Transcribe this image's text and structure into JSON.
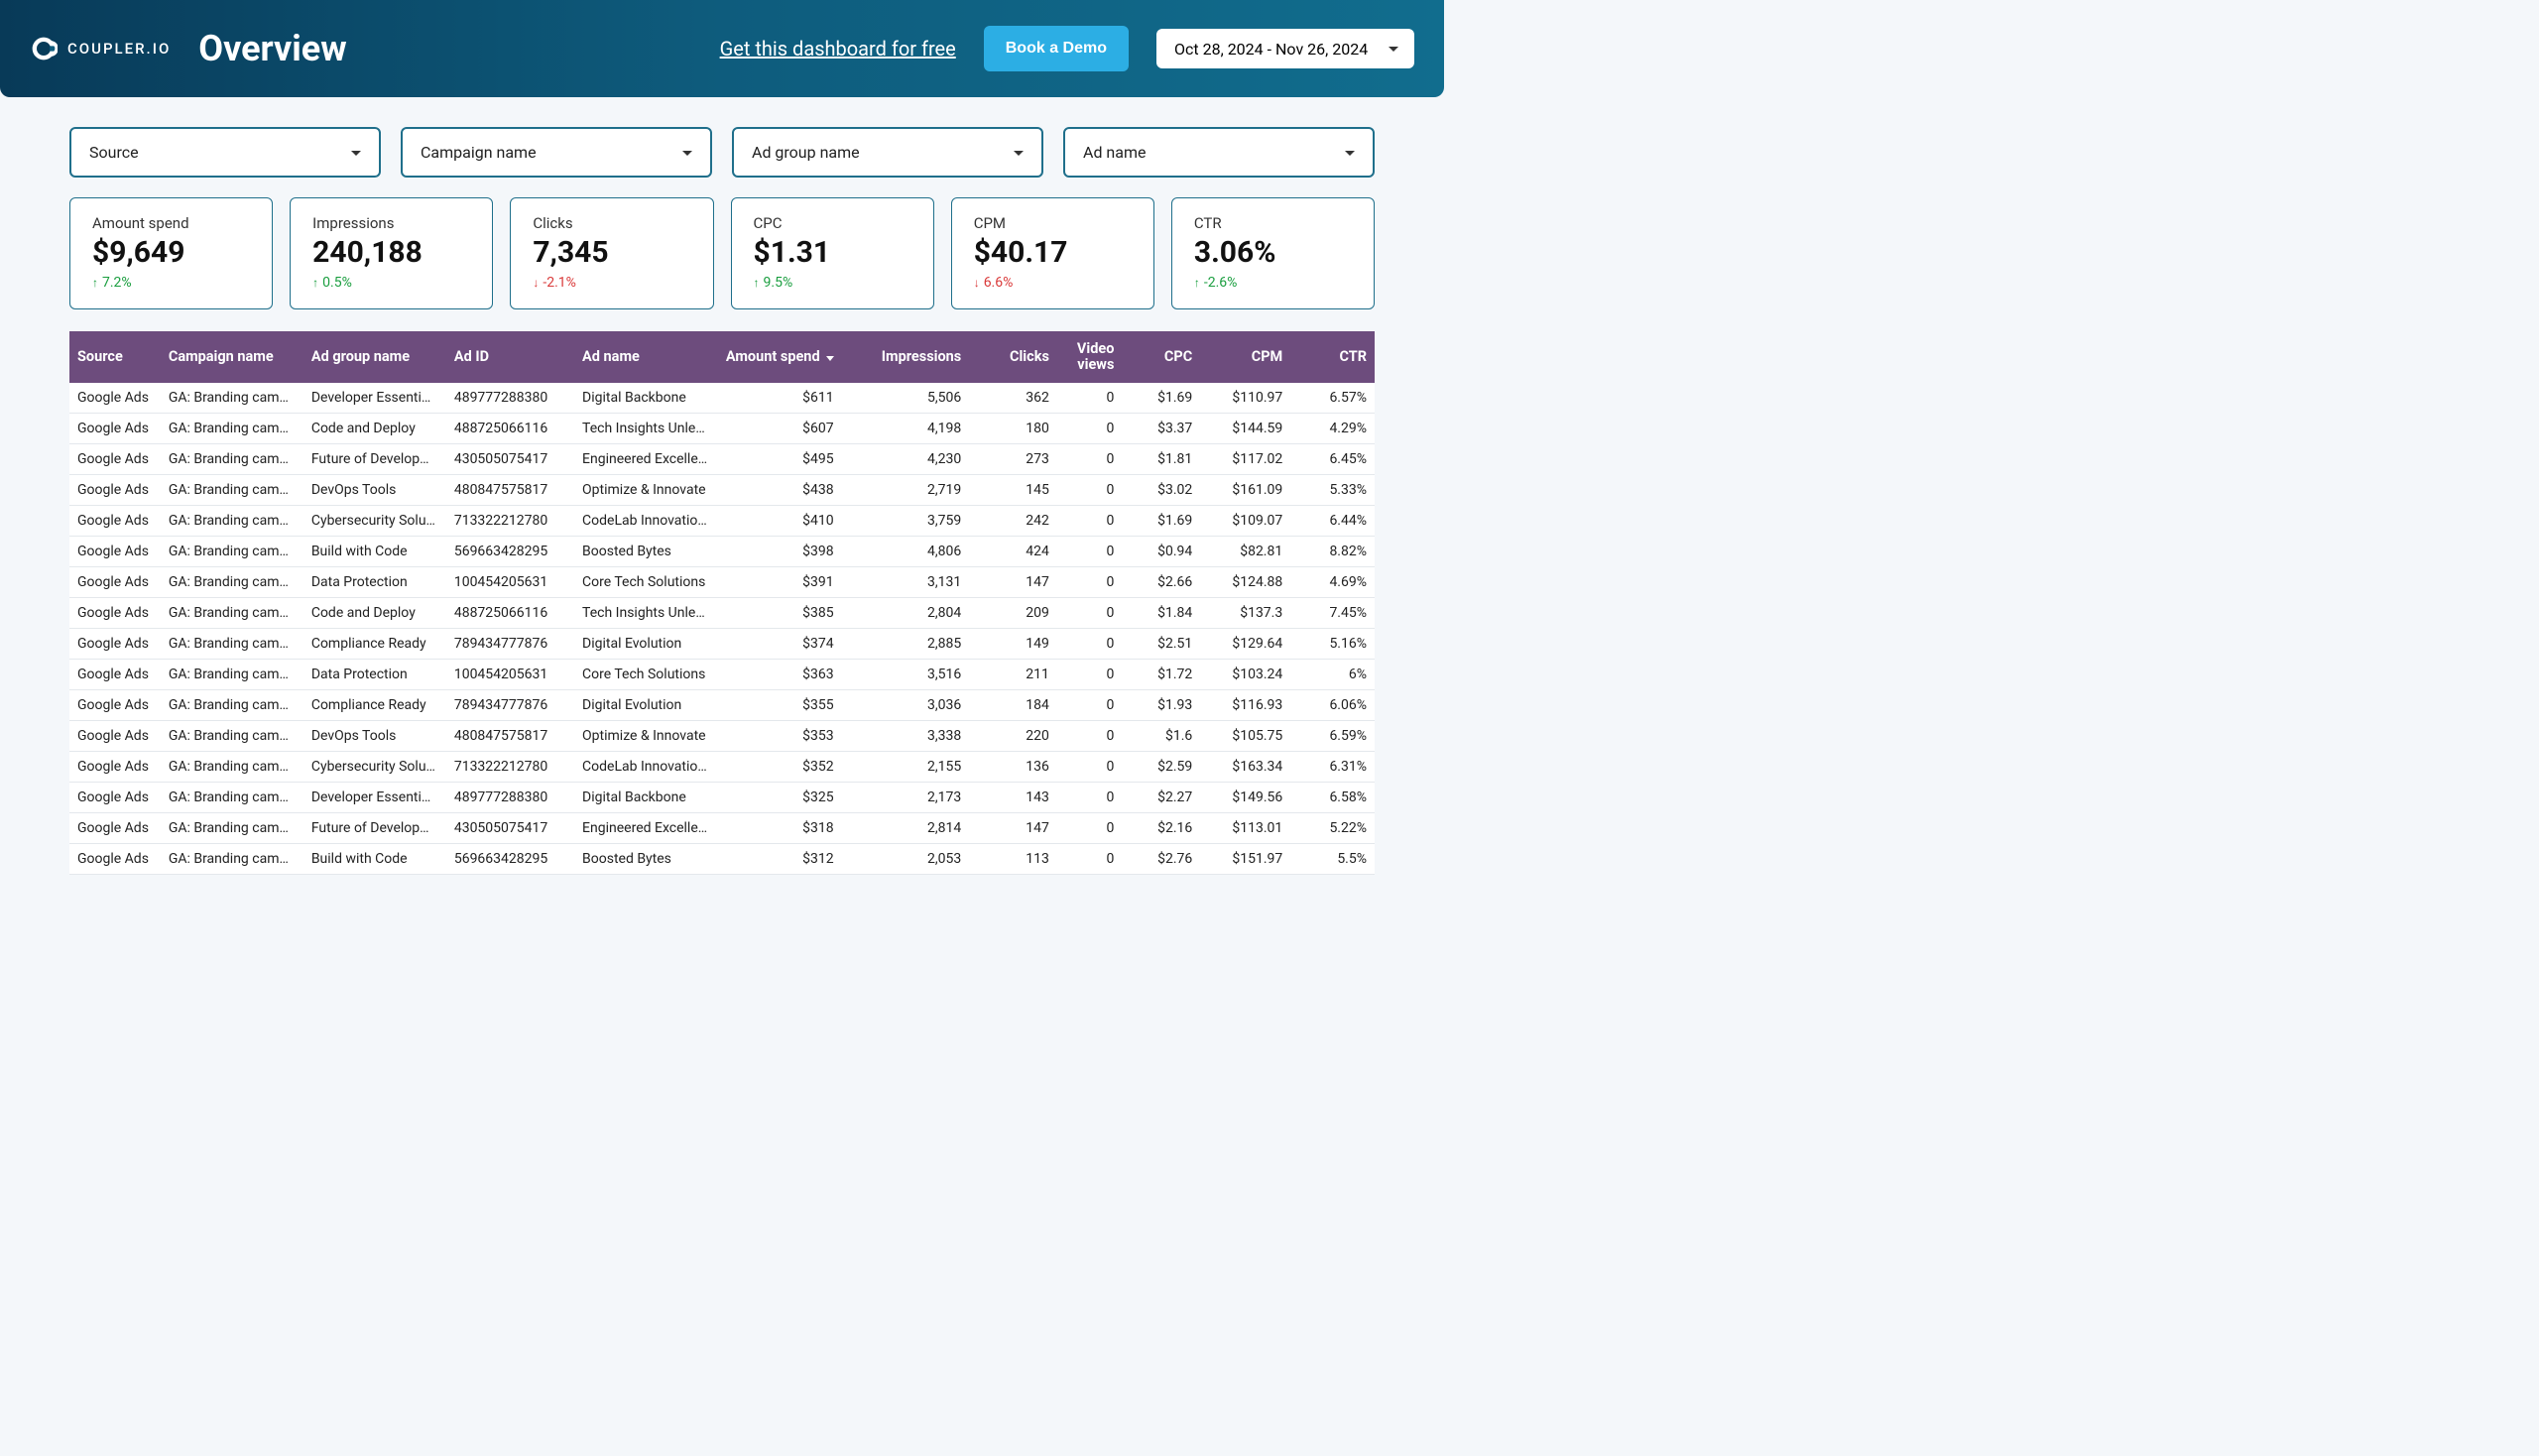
{
  "header": {
    "brand": "COUPLER.IO",
    "title": "Overview",
    "dashboard_link": "Get this dashboard for free",
    "demo_button": "Book a Demo",
    "date_range": "Oct 28, 2024 - Nov 26, 2024"
  },
  "filters": [
    {
      "label": "Source"
    },
    {
      "label": "Campaign name"
    },
    {
      "label": "Ad group name"
    },
    {
      "label": "Ad name"
    }
  ],
  "metrics": [
    {
      "label": "Amount spend",
      "value": "$9,649",
      "delta": "7.2%",
      "direction": "up"
    },
    {
      "label": "Impressions",
      "value": "240,188",
      "delta": "0.5%",
      "direction": "up"
    },
    {
      "label": "Clicks",
      "value": "7,345",
      "delta": "-2.1%",
      "direction": "down"
    },
    {
      "label": "CPC",
      "value": "$1.31",
      "delta": "9.5%",
      "direction": "up"
    },
    {
      "label": "CPM",
      "value": "$40.17",
      "delta": "6.6%",
      "direction": "down"
    },
    {
      "label": "CTR",
      "value": "3.06%",
      "delta": "-2.6%",
      "direction": "up"
    }
  ],
  "table": {
    "columns": [
      "Source",
      "Campaign name",
      "Ad group name",
      "Ad ID",
      "Ad name",
      "Amount spend",
      "Impressions",
      "Clicks",
      "Video views",
      "CPC",
      "CPM",
      "CTR"
    ],
    "sort_column": "Amount spend",
    "sort_direction": "desc",
    "rows": [
      {
        "source": "Google Ads",
        "campaign": "GA: Branding camp…",
        "adgroup": "Developer Essentials",
        "adid": "489777288380",
        "adname": "Digital Backbone",
        "spend": "$611",
        "impr": "5,506",
        "clicks": "362",
        "video": "0",
        "cpc": "$1.69",
        "cpm": "$110.97",
        "ctr": "6.57%"
      },
      {
        "source": "Google Ads",
        "campaign": "GA: Branding camp…",
        "adgroup": "Code and Deploy",
        "adid": "488725066116",
        "adname": "Tech Insights Unle…",
        "spend": "$607",
        "impr": "4,198",
        "clicks": "180",
        "video": "0",
        "cpc": "$3.37",
        "cpm": "$144.59",
        "ctr": "4.29%"
      },
      {
        "source": "Google Ads",
        "campaign": "GA: Branding camp…",
        "adgroup": "Future of Develop…",
        "adid": "430505075417",
        "adname": "Engineered Excelle…",
        "spend": "$495",
        "impr": "4,230",
        "clicks": "273",
        "video": "0",
        "cpc": "$1.81",
        "cpm": "$117.02",
        "ctr": "6.45%"
      },
      {
        "source": "Google Ads",
        "campaign": "GA: Branding camp…",
        "adgroup": "DevOps Tools",
        "adid": "480847575817",
        "adname": "Optimize & Innovate",
        "spend": "$438",
        "impr": "2,719",
        "clicks": "145",
        "video": "0",
        "cpc": "$3.02",
        "cpm": "$161.09",
        "ctr": "5.33%"
      },
      {
        "source": "Google Ads",
        "campaign": "GA: Branding camp…",
        "adgroup": "Cybersecurity Solut…",
        "adid": "713322212780",
        "adname": "CodeLab Innovatio…",
        "spend": "$410",
        "impr": "3,759",
        "clicks": "242",
        "video": "0",
        "cpc": "$1.69",
        "cpm": "$109.07",
        "ctr": "6.44%"
      },
      {
        "source": "Google Ads",
        "campaign": "GA: Branding camp…",
        "adgroup": "Build with Code",
        "adid": "569663428295",
        "adname": "Boosted Bytes",
        "spend": "$398",
        "impr": "4,806",
        "clicks": "424",
        "video": "0",
        "cpc": "$0.94",
        "cpm": "$82.81",
        "ctr": "8.82%"
      },
      {
        "source": "Google Ads",
        "campaign": "GA: Branding camp…",
        "adgroup": "Data Protection",
        "adid": "100454205631",
        "adname": "Core Tech Solutions",
        "spend": "$391",
        "impr": "3,131",
        "clicks": "147",
        "video": "0",
        "cpc": "$2.66",
        "cpm": "$124.88",
        "ctr": "4.69%"
      },
      {
        "source": "Google Ads",
        "campaign": "GA: Branding camp…",
        "adgroup": "Code and Deploy",
        "adid": "488725066116",
        "adname": "Tech Insights Unle…",
        "spend": "$385",
        "impr": "2,804",
        "clicks": "209",
        "video": "0",
        "cpc": "$1.84",
        "cpm": "$137.3",
        "ctr": "7.45%"
      },
      {
        "source": "Google Ads",
        "campaign": "GA: Branding camp…",
        "adgroup": "Compliance Ready",
        "adid": "789434777876",
        "adname": "Digital Evolution",
        "spend": "$374",
        "impr": "2,885",
        "clicks": "149",
        "video": "0",
        "cpc": "$2.51",
        "cpm": "$129.64",
        "ctr": "5.16%"
      },
      {
        "source": "Google Ads",
        "campaign": "GA: Branding camp…",
        "adgroup": "Data Protection",
        "adid": "100454205631",
        "adname": "Core Tech Solutions",
        "spend": "$363",
        "impr": "3,516",
        "clicks": "211",
        "video": "0",
        "cpc": "$1.72",
        "cpm": "$103.24",
        "ctr": "6%"
      },
      {
        "source": "Google Ads",
        "campaign": "GA: Branding camp…",
        "adgroup": "Compliance Ready",
        "adid": "789434777876",
        "adname": "Digital Evolution",
        "spend": "$355",
        "impr": "3,036",
        "clicks": "184",
        "video": "0",
        "cpc": "$1.93",
        "cpm": "$116.93",
        "ctr": "6.06%"
      },
      {
        "source": "Google Ads",
        "campaign": "GA: Branding camp…",
        "adgroup": "DevOps Tools",
        "adid": "480847575817",
        "adname": "Optimize & Innovate",
        "spend": "$353",
        "impr": "3,338",
        "clicks": "220",
        "video": "0",
        "cpc": "$1.6",
        "cpm": "$105.75",
        "ctr": "6.59%"
      },
      {
        "source": "Google Ads",
        "campaign": "GA: Branding camp…",
        "adgroup": "Cybersecurity Solut…",
        "adid": "713322212780",
        "adname": "CodeLab Innovatio…",
        "spend": "$352",
        "impr": "2,155",
        "clicks": "136",
        "video": "0",
        "cpc": "$2.59",
        "cpm": "$163.34",
        "ctr": "6.31%"
      },
      {
        "source": "Google Ads",
        "campaign": "GA: Branding camp…",
        "adgroup": "Developer Essentials",
        "adid": "489777288380",
        "adname": "Digital Backbone",
        "spend": "$325",
        "impr": "2,173",
        "clicks": "143",
        "video": "0",
        "cpc": "$2.27",
        "cpm": "$149.56",
        "ctr": "6.58%"
      },
      {
        "source": "Google Ads",
        "campaign": "GA: Branding camp…",
        "adgroup": "Future of Develop…",
        "adid": "430505075417",
        "adname": "Engineered Excelle…",
        "spend": "$318",
        "impr": "2,814",
        "clicks": "147",
        "video": "0",
        "cpc": "$2.16",
        "cpm": "$113.01",
        "ctr": "5.22%"
      },
      {
        "source": "Google Ads",
        "campaign": "GA: Branding camp…",
        "adgroup": "Build with Code",
        "adid": "569663428295",
        "adname": "Boosted Bytes",
        "spend": "$312",
        "impr": "2,053",
        "clicks": "113",
        "video": "0",
        "cpc": "$2.76",
        "cpm": "$151.97",
        "ctr": "5.5%"
      }
    ]
  }
}
